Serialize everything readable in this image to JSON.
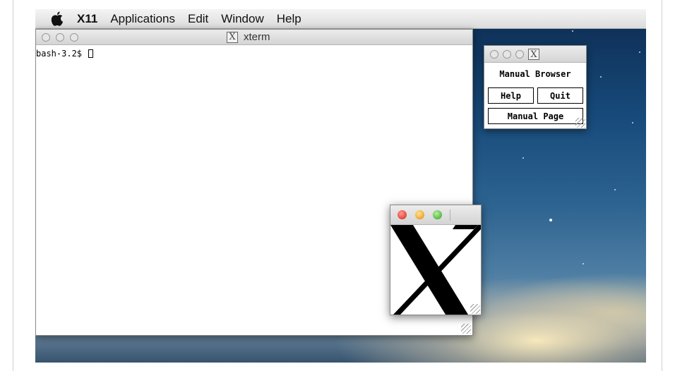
{
  "menubar": {
    "app_name": "X11",
    "items": [
      "Applications",
      "Edit",
      "Window",
      "Help"
    ]
  },
  "xterm": {
    "title": "xterm",
    "prompt": "bash-3.2$ "
  },
  "manual_browser": {
    "heading": "Manual Browser",
    "help_button": "Help",
    "quit_button": "Quit",
    "manual_page_button": "Manual Page"
  },
  "title_icon_glyph": "X",
  "colors": {
    "close": "#e8524a",
    "minimize": "#f0b03a",
    "zoom": "#64c04f"
  }
}
